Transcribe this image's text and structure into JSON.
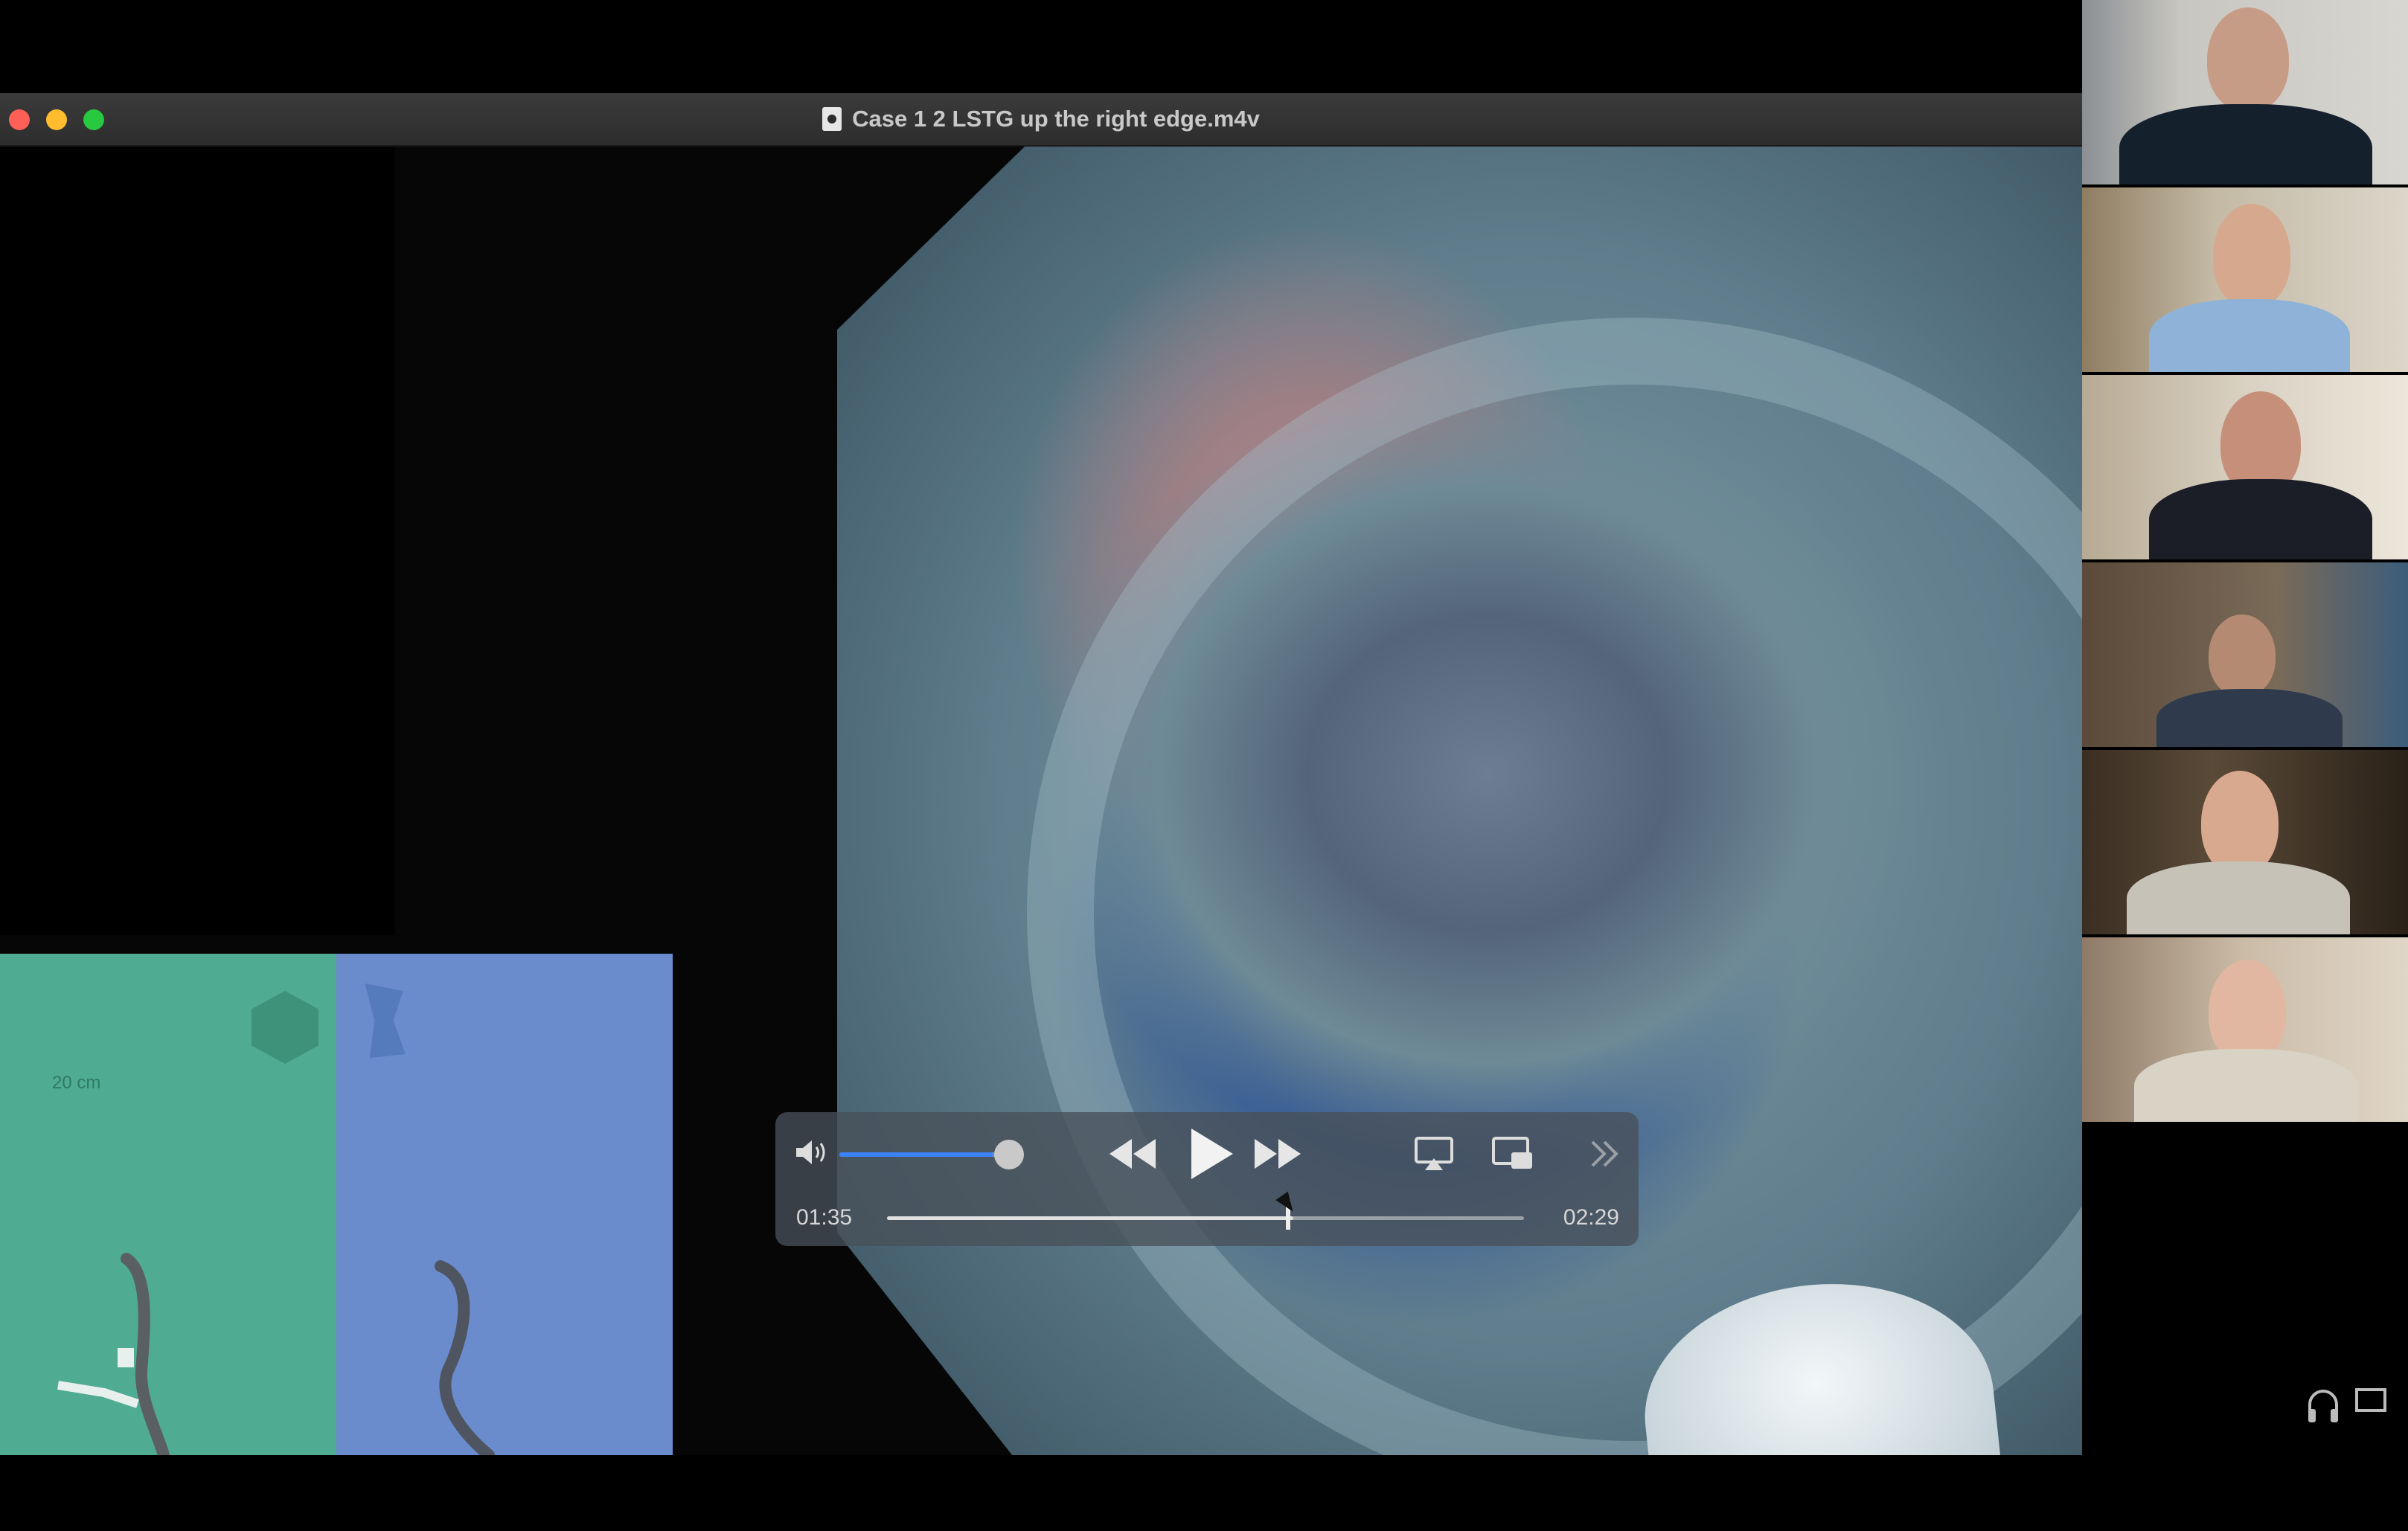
{
  "window": {
    "title": "Case 1 2 LSTG up the right edge.m4v"
  },
  "overlay": {
    "scale_label": "20 cm"
  },
  "playback": {
    "current_time": "01:35",
    "total_time": "02:29",
    "progress_fraction": 0.638,
    "volume_fraction": 0.9,
    "accent_color": "#3b82f6"
  },
  "participants": [
    {
      "name": "participant-1"
    },
    {
      "name": "participant-2"
    },
    {
      "name": "participant-3"
    },
    {
      "name": "participant-4"
    },
    {
      "name": "participant-5"
    },
    {
      "name": "participant-6"
    }
  ],
  "icons": {
    "volume": "speaker-icon",
    "rewind": "rewind-icon",
    "play": "play-icon",
    "forward": "fast-forward-icon",
    "airplay": "airplay-icon",
    "pip": "picture-in-picture-icon",
    "more": "chevron-double-right-icon",
    "headphones": "headphones-icon",
    "screen": "screen-icon"
  }
}
